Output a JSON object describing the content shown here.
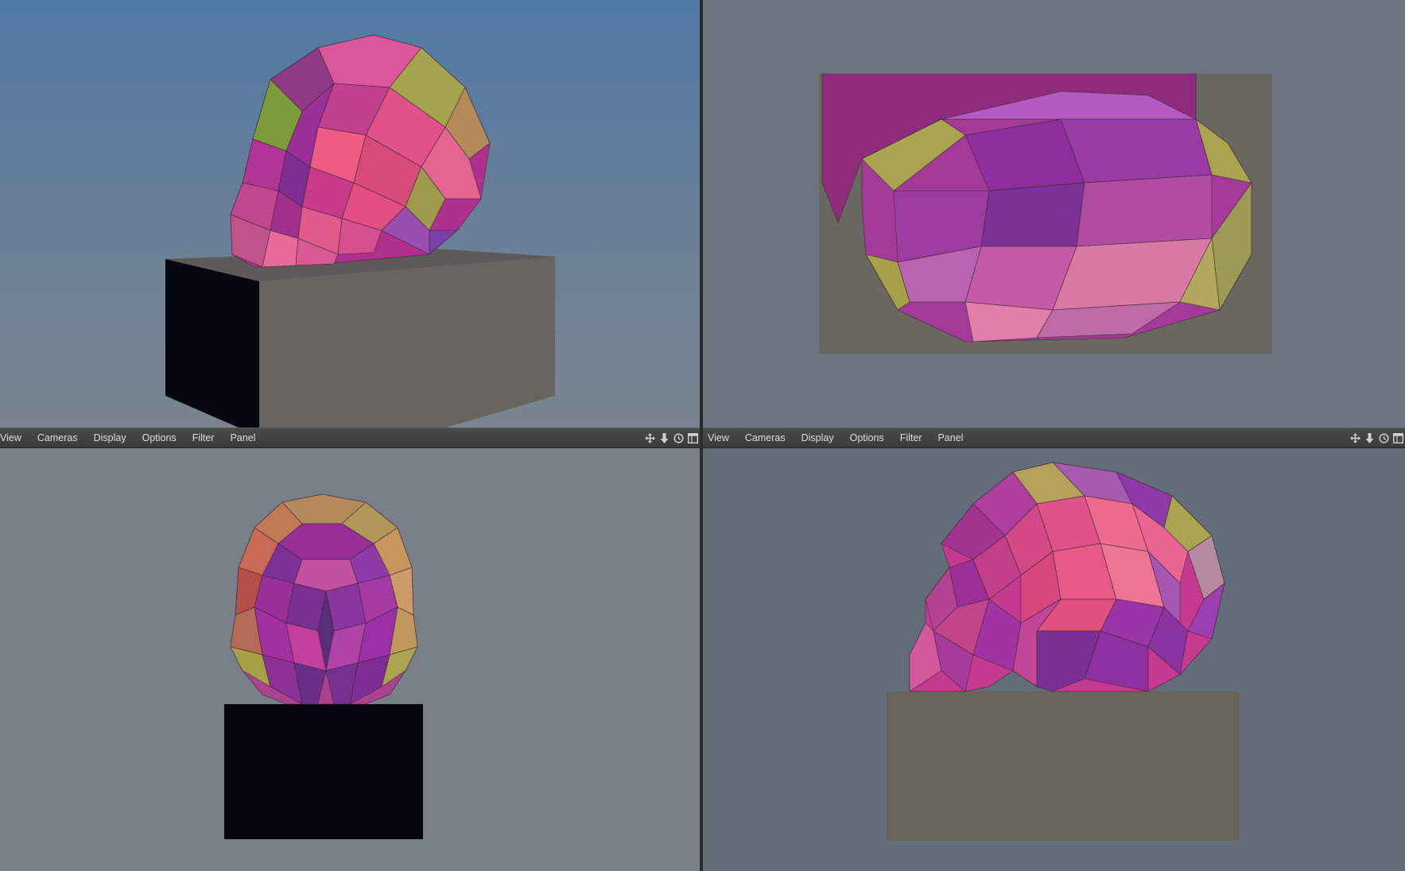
{
  "viewports": {
    "top_left": {
      "view": "perspective"
    },
    "top_right": {
      "view": "top"
    },
    "bottom_left": {
      "view": "front"
    },
    "bottom_right": {
      "view": "side"
    }
  },
  "menus": {
    "left": [
      "View",
      "Cameras",
      "Display",
      "Options",
      "Filter",
      "Panel"
    ],
    "right": [
      "View",
      "Cameras",
      "Display",
      "Options",
      "Filter",
      "Panel"
    ]
  },
  "toolbar_icons": [
    "move-icon",
    "down-arrow-icon",
    "clock-icon",
    "layout-icon"
  ],
  "colors": {
    "skull_magenta": "#b0308f",
    "skull_pink": "#e0528a",
    "skull_yellow": "#a9a94a",
    "pedestal_gray": "#6a6760",
    "pedestal_dark": "#05070f"
  }
}
